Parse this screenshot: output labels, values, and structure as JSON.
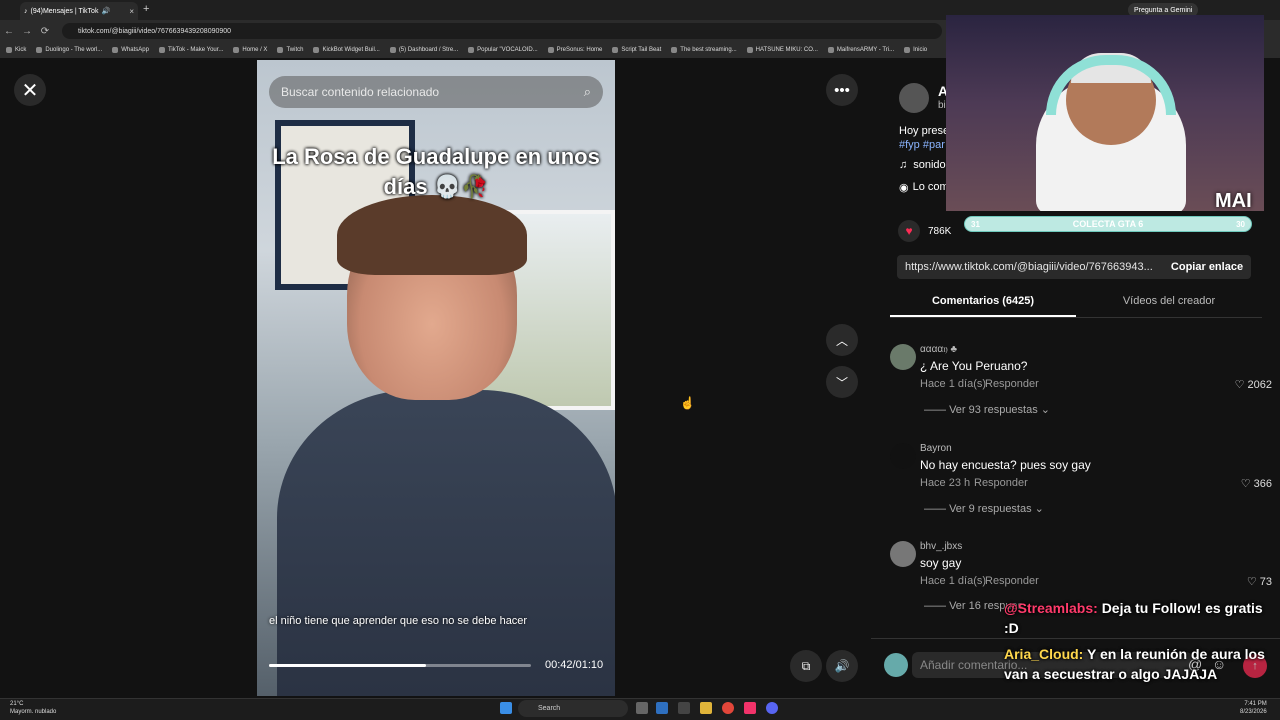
{
  "browser": {
    "tab_title": "(94)Mensajes | TikTok",
    "url": "tiktok.com/@biagiii/video/7676639439208090900",
    "gemini_label": "Pregunta a Gemini",
    "bookmarks": [
      "Kick",
      "Duolingo - The worl...",
      "WhatsApp",
      "TikTok - Make Your...",
      "Home / X",
      "Twitch",
      "KickBot Widget Buil...",
      "(5) Dashboard / Stre...",
      "Popular \"VOCALOID...",
      "PreSonus: Home",
      "Script Tail Beat",
      "The best streaming...",
      "HATSUNE MIKU: CO...",
      "MaifrensARMY - Tri...",
      "Inicio"
    ]
  },
  "video": {
    "search_placeholder": "Buscar contenido relacionado",
    "caption": "La Rosa de Guadalupe en unos días 💀🥀",
    "subtitle": "el niño tiene que aprender que eso no se debe hacer",
    "time": "00:42/01:10",
    "progress": 0.6
  },
  "panel": {
    "author_initial": "A",
    "author_sub": "bi",
    "desc": "Hoy prese",
    "tags": "#fyp #par",
    "sound": "sonido",
    "comments_hint": "Lo com",
    "likes": "786K",
    "link": "https://www.tiktok.com/@biagiii/video/767663943...",
    "copy_label": "Copiar enlace",
    "tab_comments": "Comentarios (6425)",
    "tab_videos": "Vídeos del creador",
    "comments": [
      {
        "user": "αααα𝔶 ♣",
        "text": "¿ Are You Peruano?",
        "meta": "Hace 1 día(s)",
        "reply": "Responder",
        "likes": "2062",
        "more": "Ver 93 respuestas"
      },
      {
        "user": "Bayron",
        "text": "No hay encuesta? pues soy gay",
        "meta": "Hace 23 h",
        "reply": "Responder",
        "likes": "366",
        "more": "Ver 9 respuestas"
      },
      {
        "user": "bhv_.jbxs",
        "text": "soy gay",
        "meta": "Hace 1 día(s)",
        "reply": "Responder",
        "likes": "73",
        "more": "Ver 16 respues"
      }
    ],
    "add_comment": "Añadir comentario..."
  },
  "stream": {
    "streamer_tag": "MAI",
    "goal_label": "COLECTA GTA 6",
    "goal_left": "31",
    "goal_right": "30",
    "chat": [
      {
        "user": "@Streamlabs:",
        "msg": "Deja tu Follow! es gratis :D"
      },
      {
        "user": "Aria_Cloud:",
        "msg": "Y en la reunión de aura los van a secuestrar o algo JAJAJA"
      }
    ]
  },
  "taskbar": {
    "temp": "21°C",
    "weather": "Mayorm. nublado",
    "search": "Search",
    "time": "7:41 PM",
    "date": "8/23/2026"
  }
}
